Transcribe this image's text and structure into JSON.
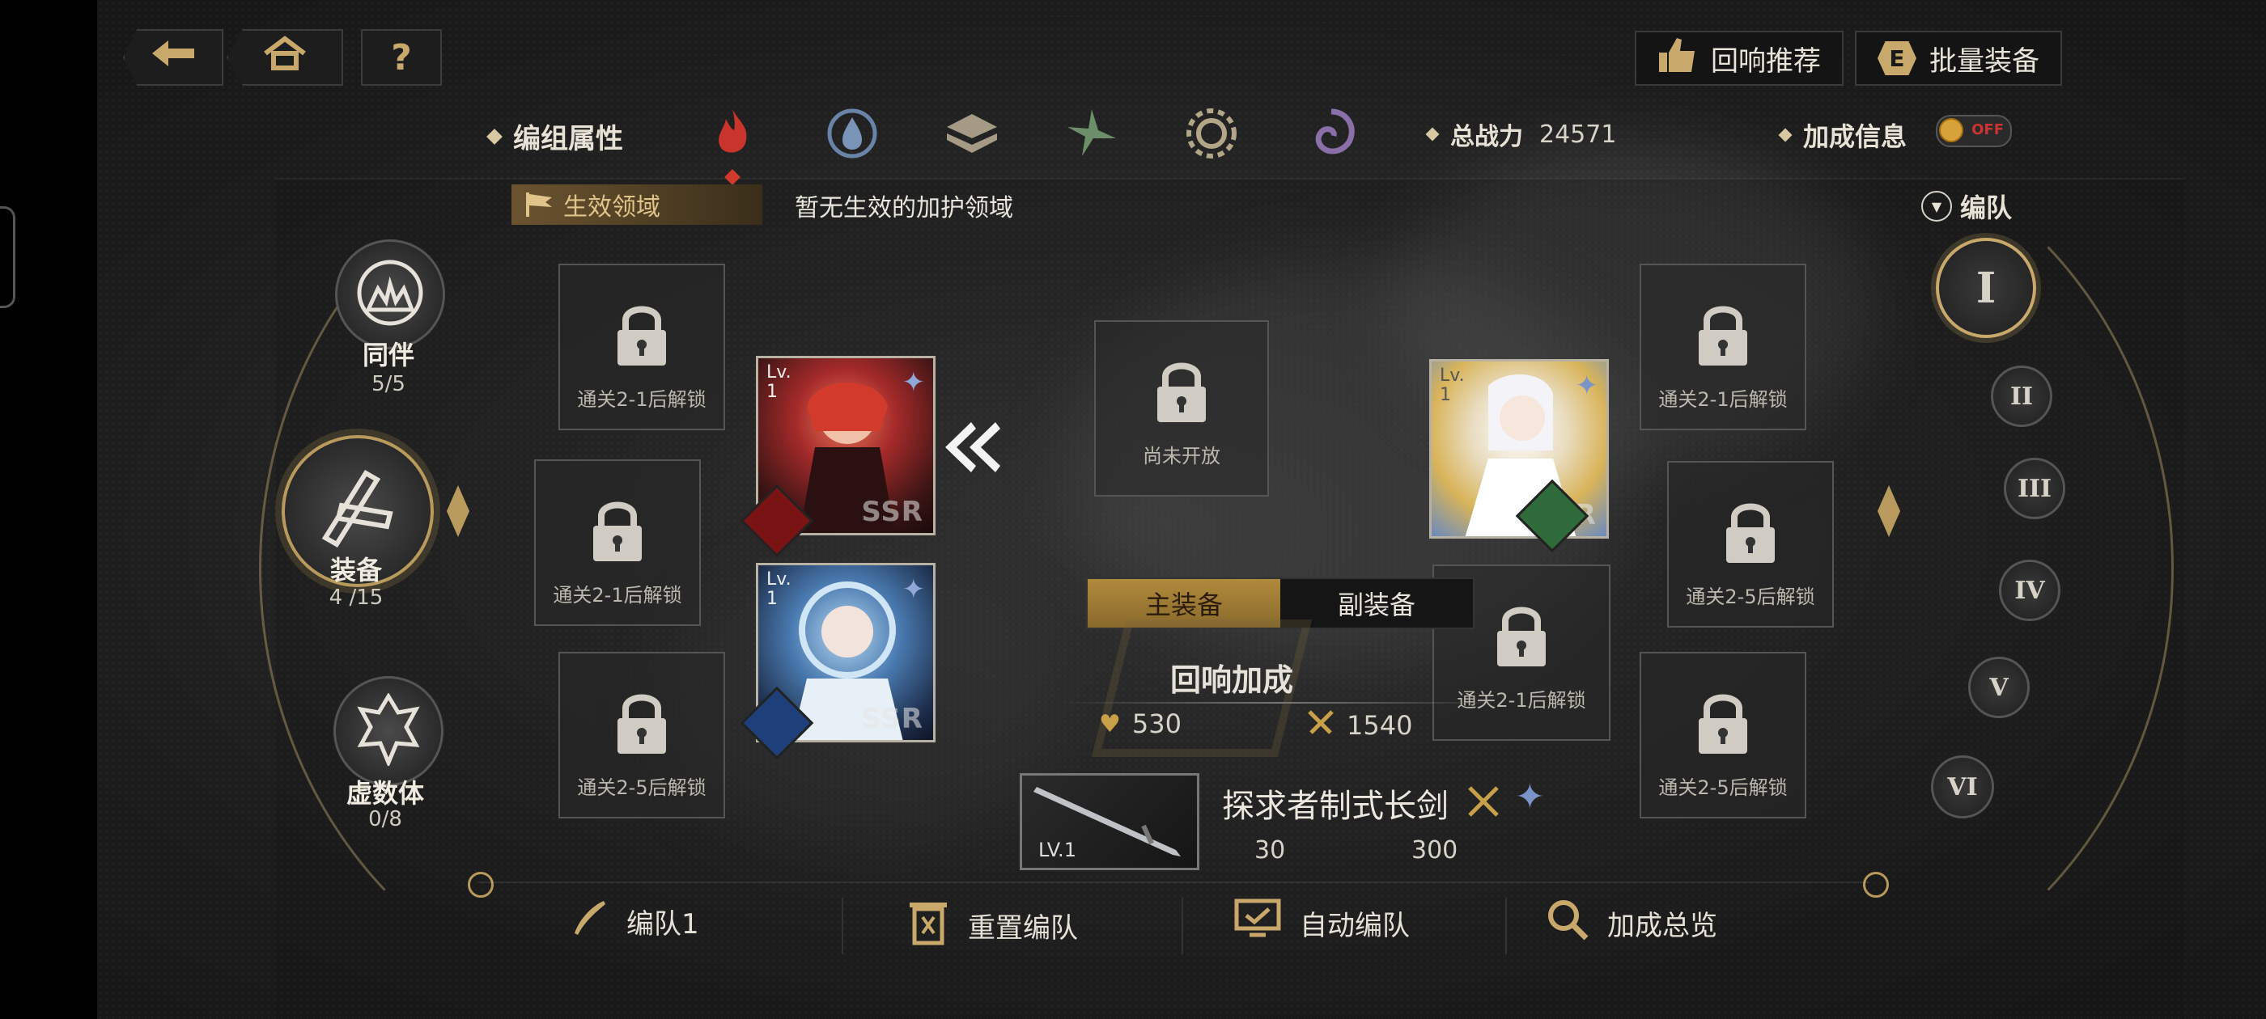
{
  "nav": {
    "back_icon": "back-arrow-icon",
    "home_icon": "home-icon",
    "help_label": "?"
  },
  "top_right": {
    "recommend_label": "回响推荐",
    "batch_equip_label": "批量装备",
    "batch_key": "E"
  },
  "attr_bar": {
    "group_attr_label": "编组属性",
    "elements": [
      "fire",
      "water",
      "earth",
      "wind",
      "light",
      "dark"
    ],
    "selected_element": "fire",
    "total_power_label": "总战力",
    "total_power_value": "24571",
    "bonus_info_label": "加成信息",
    "bonus_toggle_state": "OFF"
  },
  "domain": {
    "tag_label": "生效领域",
    "text": "暂无生效的加护领域"
  },
  "left_nav": {
    "companion": {
      "label": "同伴",
      "count": "5/5"
    },
    "equipment": {
      "label": "装备",
      "count": "4 /15"
    },
    "imaginary": {
      "label": "虚数体",
      "count": "0/8"
    }
  },
  "team_label": "编队",
  "team_tabs": [
    "I",
    "II",
    "III",
    "IV",
    "V",
    "VI"
  ],
  "selected_team": "I",
  "slots": {
    "left_top": "通关2-1后解锁",
    "left_mid": "通关2-1后解锁",
    "left_bottom": "通关2-5后解锁",
    "center_top": "尚未开放",
    "right_top": "通关2-1后解锁",
    "right_mid": "通关2-5后解锁",
    "right_center": "通关2-1后解锁",
    "right_bottom": "通关2-5后解锁"
  },
  "cards": [
    {
      "lv_label": "Lv.",
      "lv": "1",
      "rarity": "SSR",
      "element": "fire"
    },
    {
      "lv_label": "Lv.",
      "lv": "1",
      "rarity": "SSR",
      "element": "water"
    },
    {
      "lv_label": "Lv.",
      "lv": "1",
      "rarity": "SSR",
      "element": "light"
    }
  ],
  "equip_tabs": {
    "main": "主装备",
    "sub": "副装备"
  },
  "resonance": {
    "title": "回响加成",
    "hp": "530",
    "atk": "1540"
  },
  "weapon": {
    "name": "探求者制式长剑",
    "level": "LV.1",
    "stat1": "30",
    "stat2": "300"
  },
  "bottom": {
    "team_name": "编队1",
    "reset": "重置编队",
    "auto": "自动编队",
    "overview": "加成总览"
  },
  "colors": {
    "gold": "#c9a96b",
    "fire": "#8a1a1a",
    "water": "#1f3f7a",
    "light": "#2f6a3a"
  }
}
